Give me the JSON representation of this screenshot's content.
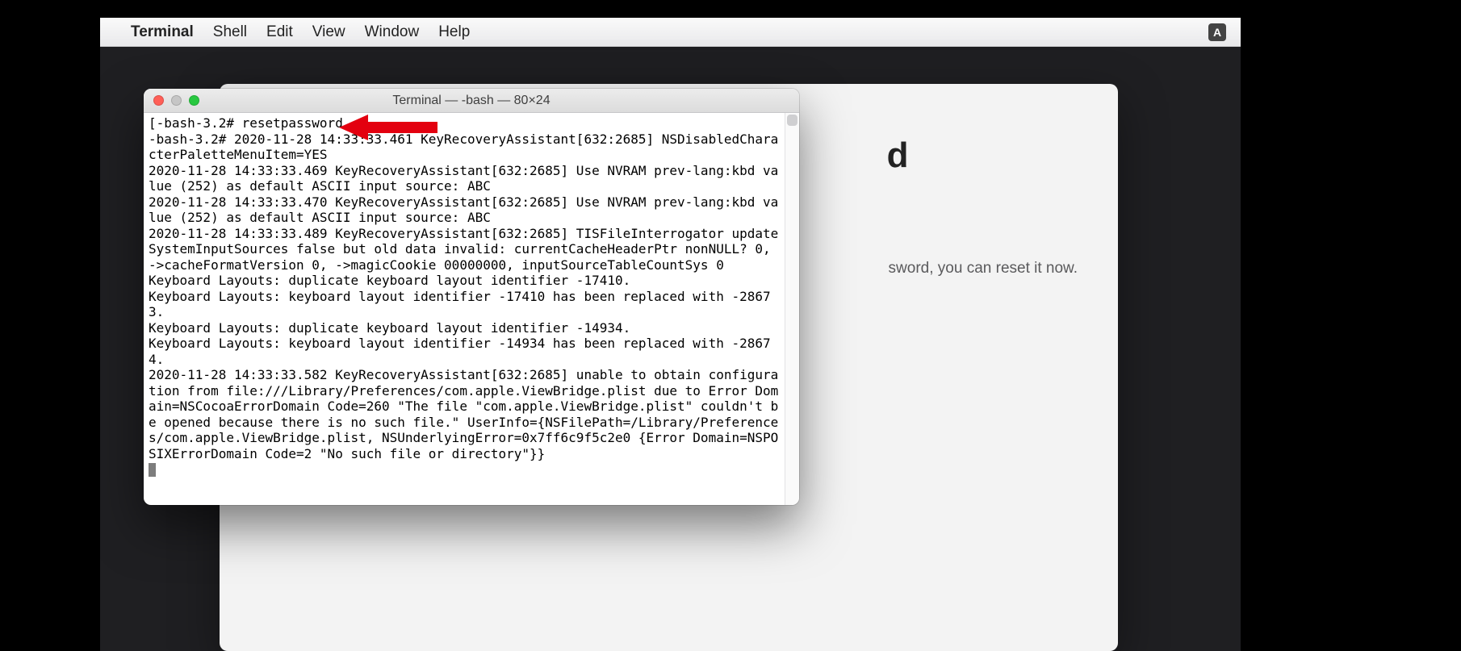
{
  "menubar": {
    "app_name": "Terminal",
    "items": [
      "Shell",
      "Edit",
      "View",
      "Window",
      "Help"
    ],
    "input_indicator": "A"
  },
  "bg_window": {
    "title_visible_fragment": "d",
    "subtitle_visible_fragment": "sword, you can reset it now."
  },
  "terminal": {
    "title": "Terminal — -bash — 80×24",
    "lines": [
      "[-bash-3.2# resetpassword",
      "-bash-3.2# 2020-11-28 14:33:33.461 KeyRecoveryAssistant[632:2685] NSDisabledCharacterPaletteMenuItem=YES",
      "2020-11-28 14:33:33.469 KeyRecoveryAssistant[632:2685] Use NVRAM prev-lang:kbd value (252) as default ASCII input source: ABC",
      "2020-11-28 14:33:33.470 KeyRecoveryAssistant[632:2685] Use NVRAM prev-lang:kbd value (252) as default ASCII input source: ABC",
      "2020-11-28 14:33:33.489 KeyRecoveryAssistant[632:2685] TISFileInterrogator updateSystemInputSources false but old data invalid: currentCacheHeaderPtr nonNULL? 0, ->cacheFormatVersion 0, ->magicCookie 00000000, inputSourceTableCountSys 0",
      "Keyboard Layouts: duplicate keyboard layout identifier -17410.",
      "Keyboard Layouts: keyboard layout identifier -17410 has been replaced with -28673.",
      "Keyboard Layouts: duplicate keyboard layout identifier -14934.",
      "Keyboard Layouts: keyboard layout identifier -14934 has been replaced with -28674.",
      "2020-11-28 14:33:33.582 KeyRecoveryAssistant[632:2685] unable to obtain configuration from file:///Library/Preferences/com.apple.ViewBridge.plist due to Error Domain=NSCocoaErrorDomain Code=260 \"The file \"com.apple.ViewBridge.plist\" couldn't be opened because there is no such file.\" UserInfo={NSFilePath=/Library/Preferences/com.apple.ViewBridge.plist, NSUnderlyingError=0x7ff6c9f5c2e0 {Error Domain=NSPOSIXErrorDomain Code=2 \"No such file or directory\"}}"
    ]
  },
  "annotation": {
    "arrow_color": "#e3000f"
  }
}
